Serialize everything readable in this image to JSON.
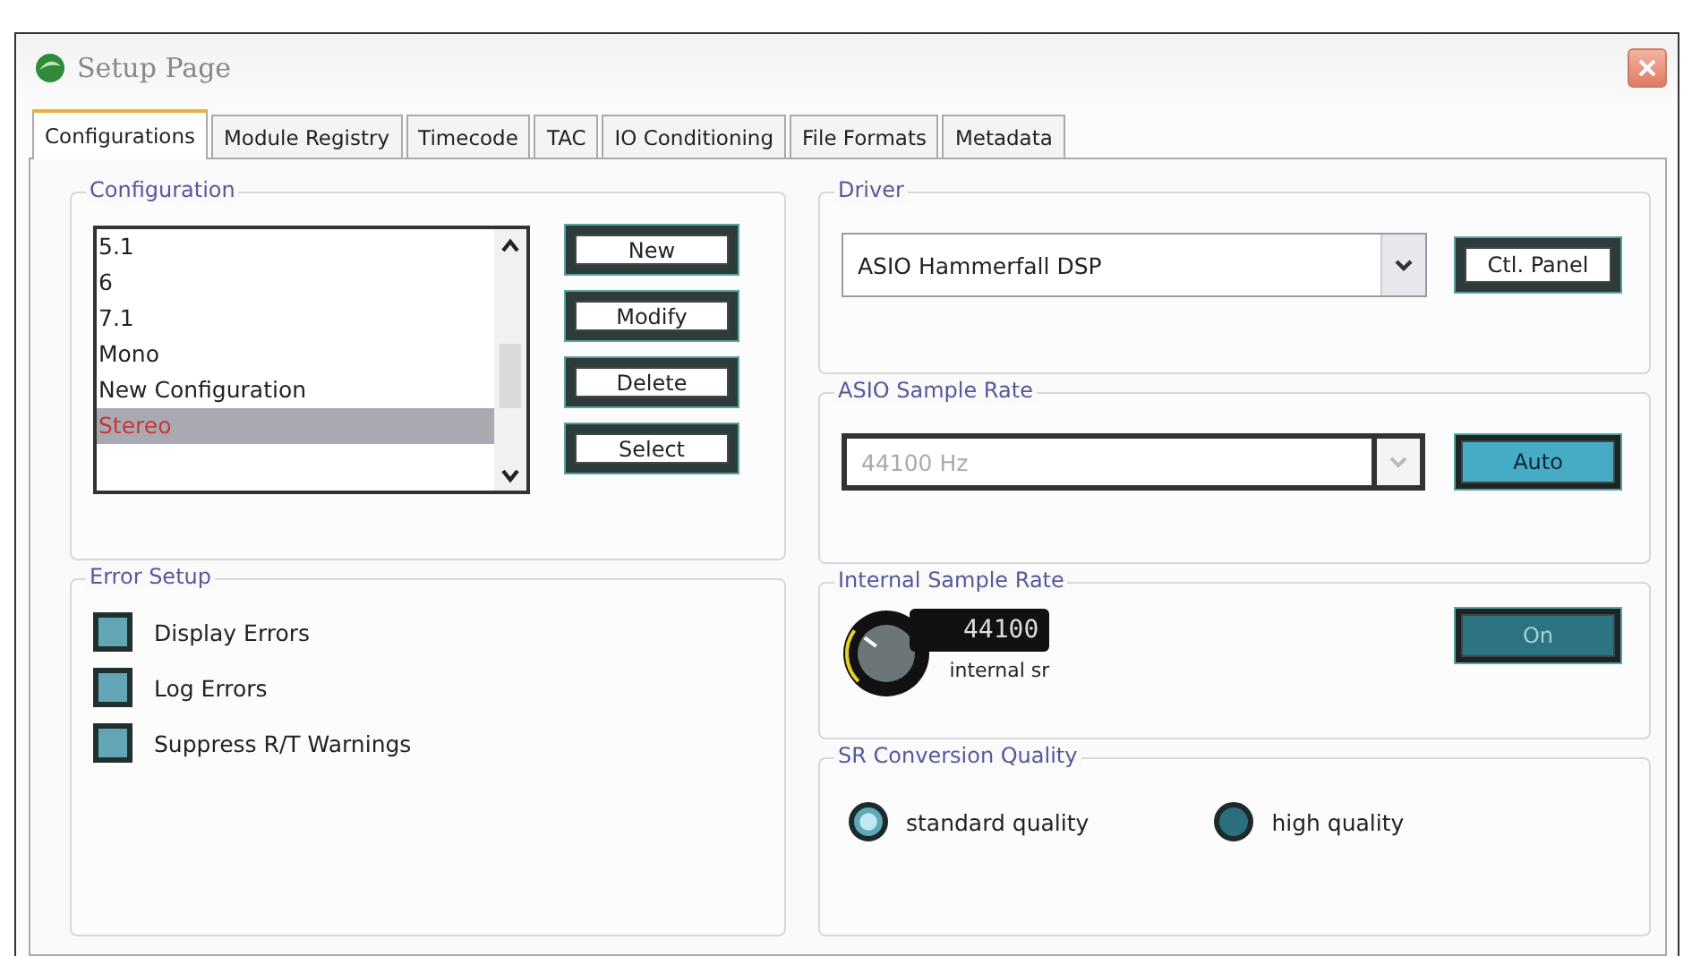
{
  "window": {
    "title": "Setup Page"
  },
  "tabs": [
    {
      "label": "Configurations",
      "selected": true
    },
    {
      "label": "Module Registry",
      "selected": false
    },
    {
      "label": "Timecode",
      "selected": false
    },
    {
      "label": "TAC",
      "selected": false
    },
    {
      "label": "IO Conditioning",
      "selected": false
    },
    {
      "label": "File Formats",
      "selected": false
    },
    {
      "label": "Metadata",
      "selected": false
    }
  ],
  "configuration": {
    "title": "Configuration",
    "items": [
      {
        "label": "5.1",
        "selected": false
      },
      {
        "label": "6",
        "selected": false
      },
      {
        "label": "7.1",
        "selected": false
      },
      {
        "label": "Mono",
        "selected": false
      },
      {
        "label": "New Configuration",
        "selected": false
      },
      {
        "label": "Stereo",
        "selected": true
      }
    ],
    "buttons": [
      "New",
      "Modify",
      "Delete",
      "Select"
    ]
  },
  "error_setup": {
    "title": "Error Setup",
    "options": [
      {
        "label": "Display Errors",
        "checked": false
      },
      {
        "label": "Log Errors",
        "checked": false
      },
      {
        "label": "Suppress R/T Warnings",
        "checked": false
      }
    ]
  },
  "driver": {
    "title": "Driver",
    "value": "ASIO Hammerfall DSP",
    "button": "Ctl. Panel"
  },
  "asio_sample_rate": {
    "title": "ASIO Sample Rate",
    "value": "44100 Hz",
    "disabled": true,
    "button": {
      "label": "Auto",
      "on": true
    }
  },
  "internal_sample_rate": {
    "title": "Internal Sample Rate",
    "reading": "44100",
    "caption": "internal sr",
    "button": {
      "label": "On",
      "on": false
    }
  },
  "sr_conversion_quality": {
    "title": "SR Conversion Quality",
    "options": [
      {
        "label": "standard quality",
        "selected": true
      },
      {
        "label": "high quality",
        "selected": false
      }
    ]
  }
}
